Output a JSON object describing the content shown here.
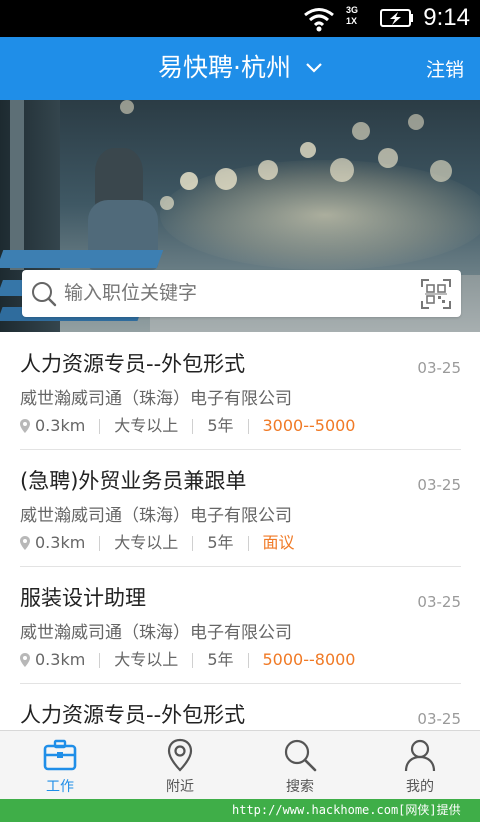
{
  "status_bar": {
    "time": "9:14",
    "network_top": "3G",
    "network_bottom": "1X"
  },
  "header": {
    "title": "易快聘·杭州",
    "logout_label": "注销"
  },
  "search": {
    "placeholder": "输入职位关键字"
  },
  "jobs": [
    {
      "title": "人力资源专员--外包形式",
      "date": "03-25",
      "company": "威世瀚威司通（珠海）电子有限公司",
      "distance": "0.3km",
      "education": "大专以上",
      "experience": "5年",
      "salary": "3000--5000"
    },
    {
      "title": "(急聘)外贸业务员兼跟单",
      "date": "03-25",
      "company": "威世瀚威司通（珠海）电子有限公司",
      "distance": "0.3km",
      "education": "大专以上",
      "experience": "5年",
      "salary": "面议"
    },
    {
      "title": "服装设计助理",
      "date": "03-25",
      "company": "威世瀚威司通（珠海）电子有限公司",
      "distance": "0.3km",
      "education": "大专以上",
      "experience": "5年",
      "salary": "5000--8000"
    },
    {
      "title": "人力资源专员--外包形式",
      "date": "03-25"
    }
  ],
  "tabs": [
    {
      "label": "工作",
      "icon": "briefcase-icon",
      "active": true
    },
    {
      "label": "附近",
      "icon": "location-pin-icon"
    },
    {
      "label": "搜索",
      "icon": "search-icon"
    },
    {
      "label": "我的",
      "icon": "user-icon"
    }
  ],
  "colors": {
    "primary": "#1f8ee8",
    "salary": "#f07a26",
    "watermark_bg": "#3fae48"
  },
  "watermark": "http://www.hackhome.com[网侠]提供"
}
